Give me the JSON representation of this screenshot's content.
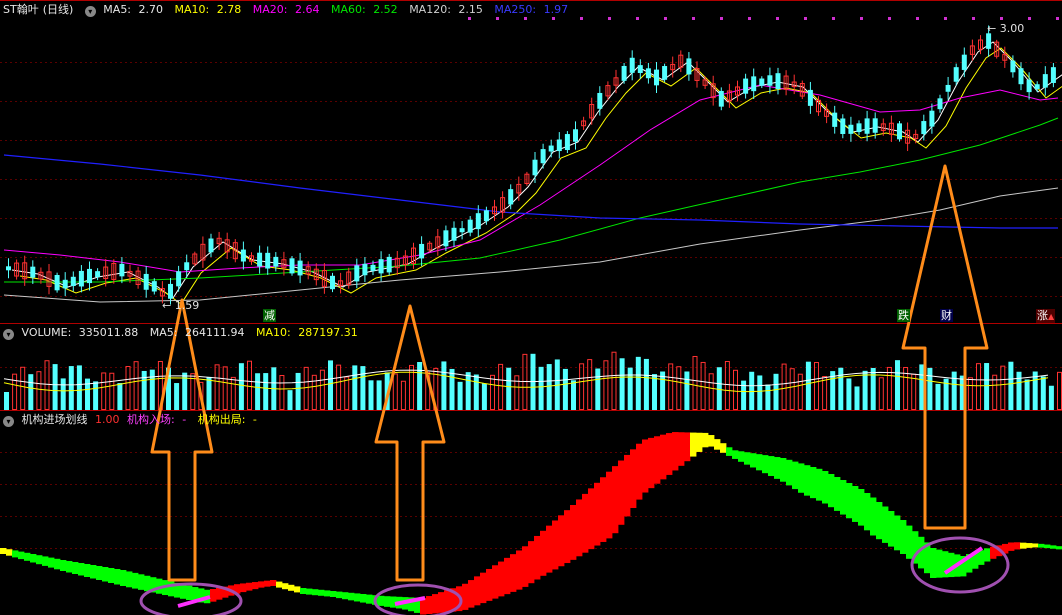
{
  "main": {
    "header": {
      "symbol": "ST翰叶",
      "period": "(日线)",
      "ma5_label": "MA5:",
      "ma5": "2.70",
      "ma10_label": "MA10:",
      "ma10": "2.78",
      "ma20_label": "MA20:",
      "ma20": "2.64",
      "ma60_label": "MA60:",
      "ma60": "2.52",
      "ma120_label": "MA120:",
      "ma120": "2.15",
      "ma250_label": "MA250:",
      "ma250": "1.97"
    },
    "high_marker": "3.00",
    "low_marker": "1.59",
    "badges": {
      "reduce": "减",
      "fall": "跌",
      "finance": "财",
      "rise": "涨"
    }
  },
  "volume": {
    "label": "VOLUME:",
    "value": "335011.88",
    "ma5_label": "MA5:",
    "ma5": "264111.94",
    "ma10_label": "MA10:",
    "ma10": "287197.31"
  },
  "indicator": {
    "name": "机构进场划线",
    "value": "1.00",
    "entry_label": "机构入场:",
    "entry_value": "-",
    "exit_label": "机构出局:",
    "exit_value": "-"
  },
  "colors": {
    "up": "#ff3232",
    "down": "#54ffff",
    "ma5": "#ffffff",
    "ma10": "#ffff00",
    "ma20": "#ff00ff",
    "ma60": "#00e600",
    "ma120": "#c8c8c8",
    "ma250": "#2020ff",
    "arrow": "#ff8c1a",
    "circle": "#a050b0"
  }
}
